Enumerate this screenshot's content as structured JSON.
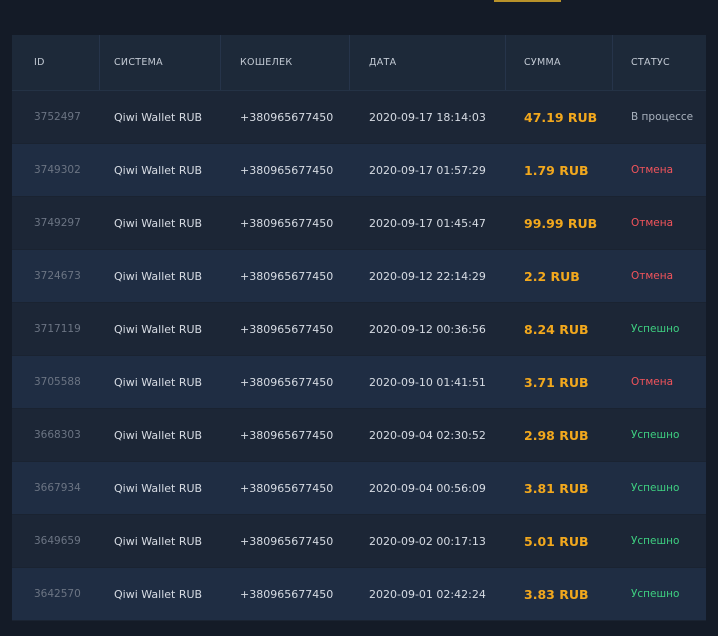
{
  "header": {
    "id": "ID",
    "system": "СИСТЕМА",
    "wallet": "КОШЕЛЕК",
    "date": "ДАТА",
    "amount": "СУММА",
    "status": "СТАТУС"
  },
  "rows": [
    {
      "id": "3752497",
      "system": "Qiwi Wallet RUB",
      "wallet": "+380965677450",
      "date": "2020-09-17 18:14:03",
      "amount": "47.19 RUB",
      "status": "В процессе",
      "status_type": "process"
    },
    {
      "id": "3749302",
      "system": "Qiwi Wallet RUB",
      "wallet": "+380965677450",
      "date": "2020-09-17 01:57:29",
      "amount": "1.79 RUB",
      "status": "Отмена",
      "status_type": "cancel"
    },
    {
      "id": "3749297",
      "system": "Qiwi Wallet RUB",
      "wallet": "+380965677450",
      "date": "2020-09-17 01:45:47",
      "amount": "99.99 RUB",
      "status": "Отмена",
      "status_type": "cancel"
    },
    {
      "id": "3724673",
      "system": "Qiwi Wallet RUB",
      "wallet": "+380965677450",
      "date": "2020-09-12 22:14:29",
      "amount": "2.2 RUB",
      "status": "Отмена",
      "status_type": "cancel"
    },
    {
      "id": "3717119",
      "system": "Qiwi Wallet RUB",
      "wallet": "+380965677450",
      "date": "2020-09-12 00:36:56",
      "amount": "8.24 RUB",
      "status": "Успешно",
      "status_type": "success"
    },
    {
      "id": "3705588",
      "system": "Qiwi Wallet RUB",
      "wallet": "+380965677450",
      "date": "2020-09-10 01:41:51",
      "amount": "3.71 RUB",
      "status": "Отмена",
      "status_type": "cancel"
    },
    {
      "id": "3668303",
      "system": "Qiwi Wallet RUB",
      "wallet": "+380965677450",
      "date": "2020-09-04 02:30:52",
      "amount": "2.98 RUB",
      "status": "Успешно",
      "status_type": "success"
    },
    {
      "id": "3667934",
      "system": "Qiwi Wallet RUB",
      "wallet": "+380965677450",
      "date": "2020-09-04 00:56:09",
      "amount": "3.81 RUB",
      "status": "Успешно",
      "status_type": "success"
    },
    {
      "id": "3649659",
      "system": "Qiwi Wallet RUB",
      "wallet": "+380965677450",
      "date": "2020-09-02 00:17:13",
      "amount": "5.01 RUB",
      "status": "Успешно",
      "status_type": "success"
    },
    {
      "id": "3642570",
      "system": "Qiwi Wallet RUB",
      "wallet": "+380965677450",
      "date": "2020-09-01 02:42:24",
      "amount": "3.83 RUB",
      "status": "Успешно",
      "status_type": "success"
    }
  ],
  "colors": {
    "background": "#141b27",
    "amount": "#f2a81d",
    "status_process": "#aab3bf",
    "status_cancel": "#f2545b",
    "status_success": "#3ed081"
  }
}
